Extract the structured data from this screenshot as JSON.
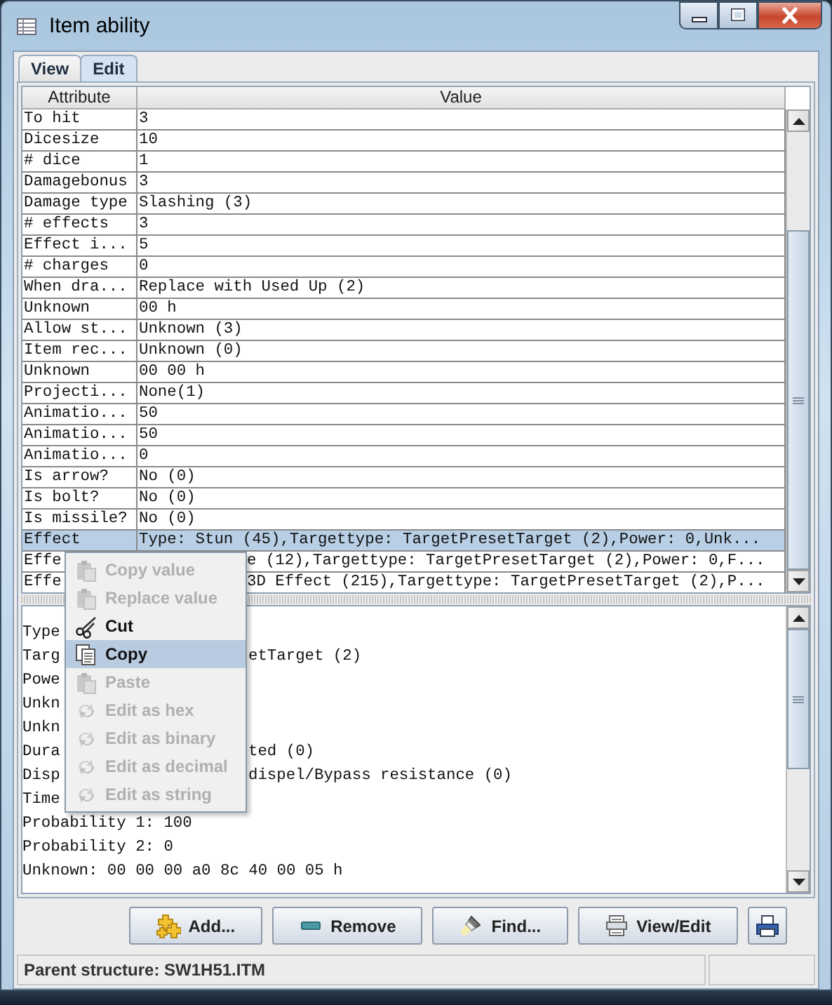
{
  "window": {
    "title": "Item ability"
  },
  "tabs": [
    {
      "label": "View",
      "selected": false
    },
    {
      "label": "Edit",
      "selected": true
    }
  ],
  "table": {
    "columns": [
      "Attribute",
      "Value"
    ],
    "rows": [
      {
        "attribute": "To hit",
        "value": "3",
        "selected": false,
        "kind": "plain"
      },
      {
        "attribute": "Dicesize",
        "value": "10",
        "selected": false,
        "kind": "plain"
      },
      {
        "attribute": "# dice",
        "value": "1",
        "selected": false,
        "kind": "plain"
      },
      {
        "attribute": "Damagebonus",
        "value": "3",
        "selected": false,
        "kind": "plain"
      },
      {
        "attribute": "Damage type",
        "value": "Slashing (3)",
        "selected": false,
        "kind": "plain"
      },
      {
        "attribute": "# effects",
        "value": "3",
        "selected": false,
        "kind": "plain"
      },
      {
        "attribute": "Effect i...",
        "value": "5",
        "selected": false,
        "kind": "plain"
      },
      {
        "attribute": "# charges",
        "value": "0",
        "selected": false,
        "kind": "plain"
      },
      {
        "attribute": "When dra...",
        "value": "Replace with Used Up (2)",
        "selected": false,
        "kind": "plain"
      },
      {
        "attribute": "Unknown",
        "value": "00 h",
        "selected": false,
        "kind": "plain"
      },
      {
        "attribute": "Allow st...",
        "value": "Unknown (3)",
        "selected": false,
        "kind": "plain"
      },
      {
        "attribute": "Item rec...",
        "value": "Unknown (0)",
        "selected": false,
        "kind": "plain"
      },
      {
        "attribute": "Unknown",
        "value": "00 00 h",
        "selected": false,
        "kind": "plain"
      },
      {
        "attribute": "Projecti...",
        "value": "None(1)",
        "selected": false,
        "kind": "plain"
      },
      {
        "attribute": "Animatio...",
        "value": "50",
        "selected": false,
        "kind": "plain"
      },
      {
        "attribute": "Animatio...",
        "value": "50",
        "selected": false,
        "kind": "plain"
      },
      {
        "attribute": "Animatio...",
        "value": "0",
        "selected": false,
        "kind": "plain"
      },
      {
        "attribute": "Is arrow?",
        "value": "No (0)",
        "selected": false,
        "kind": "plain"
      },
      {
        "attribute": "Is bolt?",
        "value": "No (0)",
        "selected": false,
        "kind": "plain"
      },
      {
        "attribute": "Is missile?",
        "value": "No (0)",
        "selected": false,
        "kind": "plain"
      },
      {
        "attribute": "Effect",
        "value": "Type: Stun (45),Targettype: TargetPresetTarget (2),Power: 0,Unk...",
        "selected": true,
        "kind": "plain"
      },
      {
        "attribute": "Effe",
        "value": "e (12),Targettype: TargetPresetTarget (2),Power: 0,F...",
        "selected": false,
        "kind": "covered"
      },
      {
        "attribute": "Effe",
        "value": "3D Effect (215),Targettype: TargetPresetTarget (2),P...",
        "selected": false,
        "kind": "covered"
      }
    ]
  },
  "context_menu": {
    "items": [
      {
        "label": "Copy value",
        "kind": "clipboard",
        "disabled": true,
        "selected": false
      },
      {
        "label": "Replace value",
        "kind": "clipboard",
        "disabled": true,
        "selected": false
      },
      {
        "label": "Cut",
        "kind": "cut",
        "disabled": false,
        "selected": false
      },
      {
        "label": "Copy",
        "kind": "copy",
        "disabled": false,
        "selected": true
      },
      {
        "label": "Paste",
        "kind": "clipboard",
        "disabled": true,
        "selected": false
      },
      {
        "label": "Edit as hex",
        "kind": "convert",
        "disabled": true,
        "selected": false
      },
      {
        "label": "Edit as binary",
        "kind": "convert",
        "disabled": true,
        "selected": false
      },
      {
        "label": "Edit as decimal",
        "kind": "convert",
        "disabled": true,
        "selected": false
      },
      {
        "label": "Edit as string",
        "kind": "convert",
        "disabled": true,
        "selected": false
      }
    ]
  },
  "details": {
    "lines": [
      {
        "start": "Type"
      },
      {
        "start": "Targ",
        "end": "etTarget (2)"
      },
      {
        "start": "Powe"
      },
      {
        "start": "Unkn"
      },
      {
        "start": "Unkn"
      },
      {
        "start": "Dura",
        "end": "ted (0)"
      },
      {
        "start": "Disp",
        "end": "dispel/Bypass resistance (0)"
      },
      {
        "start": "Time"
      },
      {
        "start": "Probability 1: 100"
      },
      {
        "start": "Probability 2: 0"
      },
      {
        "start": "Unknown: 00 00 00 a0 8c 40 00 05 h"
      }
    ]
  },
  "buttons": [
    {
      "label": "Add...",
      "kind": "add"
    },
    {
      "label": "Remove",
      "kind": "remove"
    },
    {
      "label": "Find...",
      "kind": "find"
    },
    {
      "label": "View/Edit",
      "kind": "view"
    },
    {
      "kind": "print"
    }
  ],
  "status_bar": {
    "text": "Parent structure: SW1H51.ITM"
  }
}
